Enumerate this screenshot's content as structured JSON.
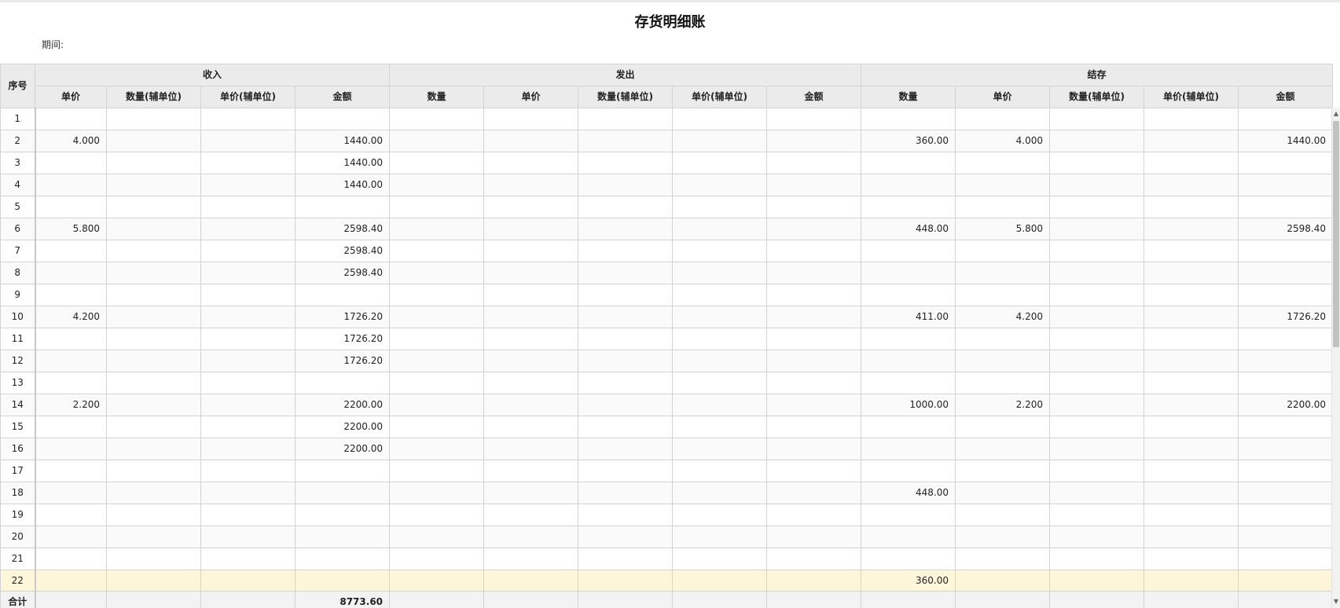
{
  "page": {
    "title": "存货明细账",
    "period_label": "期间:"
  },
  "table": {
    "seq_header": "序号",
    "groups": [
      "收入",
      "发出",
      "结存"
    ],
    "columns": [
      "单价",
      "数量(辅单位)",
      "单价(辅单位)",
      "金额",
      "数量",
      "单价",
      "数量(辅单位)",
      "单价(辅单位)",
      "金额",
      "数量",
      "单价",
      "数量(辅单位)",
      "单价(辅单位)",
      "金额"
    ],
    "rows": [
      [
        "1",
        "",
        "",
        "",
        "",
        "",
        "",
        "",
        "",
        "",
        "",
        "",
        "",
        "",
        ""
      ],
      [
        "2",
        "4.000",
        "",
        "",
        "1440.00",
        "",
        "",
        "",
        "",
        "",
        "360.00",
        "4.000",
        "",
        "",
        "1440.00"
      ],
      [
        "3",
        "",
        "",
        "",
        "1440.00",
        "",
        "",
        "",
        "",
        "",
        "",
        "",
        "",
        "",
        ""
      ],
      [
        "4",
        "",
        "",
        "",
        "1440.00",
        "",
        "",
        "",
        "",
        "",
        "",
        "",
        "",
        "",
        ""
      ],
      [
        "5",
        "",
        "",
        "",
        "",
        "",
        "",
        "",
        "",
        "",
        "",
        "",
        "",
        "",
        ""
      ],
      [
        "6",
        "5.800",
        "",
        "",
        "2598.40",
        "",
        "",
        "",
        "",
        "",
        "448.00",
        "5.800",
        "",
        "",
        "2598.40"
      ],
      [
        "7",
        "",
        "",
        "",
        "2598.40",
        "",
        "",
        "",
        "",
        "",
        "",
        "",
        "",
        "",
        ""
      ],
      [
        "8",
        "",
        "",
        "",
        "2598.40",
        "",
        "",
        "",
        "",
        "",
        "",
        "",
        "",
        "",
        ""
      ],
      [
        "9",
        "",
        "",
        "",
        "",
        "",
        "",
        "",
        "",
        "",
        "",
        "",
        "",
        "",
        ""
      ],
      [
        "10",
        "4.200",
        "",
        "",
        "1726.20",
        "",
        "",
        "",
        "",
        "",
        "411.00",
        "4.200",
        "",
        "",
        "1726.20"
      ],
      [
        "11",
        "",
        "",
        "",
        "1726.20",
        "",
        "",
        "",
        "",
        "",
        "",
        "",
        "",
        "",
        ""
      ],
      [
        "12",
        "",
        "",
        "",
        "1726.20",
        "",
        "",
        "",
        "",
        "",
        "",
        "",
        "",
        "",
        ""
      ],
      [
        "13",
        "",
        "",
        "",
        "",
        "",
        "",
        "",
        "",
        "",
        "",
        "",
        "",
        "",
        ""
      ],
      [
        "14",
        "2.200",
        "",
        "",
        "2200.00",
        "",
        "",
        "",
        "",
        "",
        "1000.00",
        "2.200",
        "",
        "",
        "2200.00"
      ],
      [
        "15",
        "",
        "",
        "",
        "2200.00",
        "",
        "",
        "",
        "",
        "",
        "",
        "",
        "",
        "",
        ""
      ],
      [
        "16",
        "",
        "",
        "",
        "2200.00",
        "",
        "",
        "",
        "",
        "",
        "",
        "",
        "",
        "",
        ""
      ],
      [
        "17",
        "",
        "",
        "",
        "",
        "",
        "",
        "",
        "",
        "",
        "",
        "",
        "",
        "",
        ""
      ],
      [
        "18",
        "",
        "",
        "",
        "",
        "",
        "",
        "",
        "",
        "",
        "448.00",
        "",
        "",
        "",
        ""
      ],
      [
        "19",
        "",
        "",
        "",
        "",
        "",
        "",
        "",
        "",
        "",
        "",
        "",
        "",
        "",
        ""
      ],
      [
        "20",
        "",
        "",
        "",
        "",
        "",
        "",
        "",
        "",
        "",
        "",
        "",
        "",
        "",
        ""
      ],
      [
        "21",
        "",
        "",
        "",
        "",
        "",
        "",
        "",
        "",
        "",
        "",
        "",
        "",
        "",
        ""
      ],
      [
        "22",
        "",
        "",
        "",
        "",
        "",
        "",
        "",
        "",
        "",
        "360.00",
        "",
        "",
        "",
        ""
      ]
    ],
    "total_row": [
      "合计",
      "",
      "",
      "",
      "8773.60",
      "",
      "",
      "",
      "",
      "",
      "",
      "",
      "",
      "",
      ""
    ]
  },
  "icons": {
    "scroll_up": "scroll-up-arrow-icon",
    "scroll_down": "scroll-down-arrow-icon"
  },
  "colors": {
    "header_bg": "#ebebeb",
    "highlight_row": "#fdf6d8",
    "border": "#d3d3d3"
  }
}
